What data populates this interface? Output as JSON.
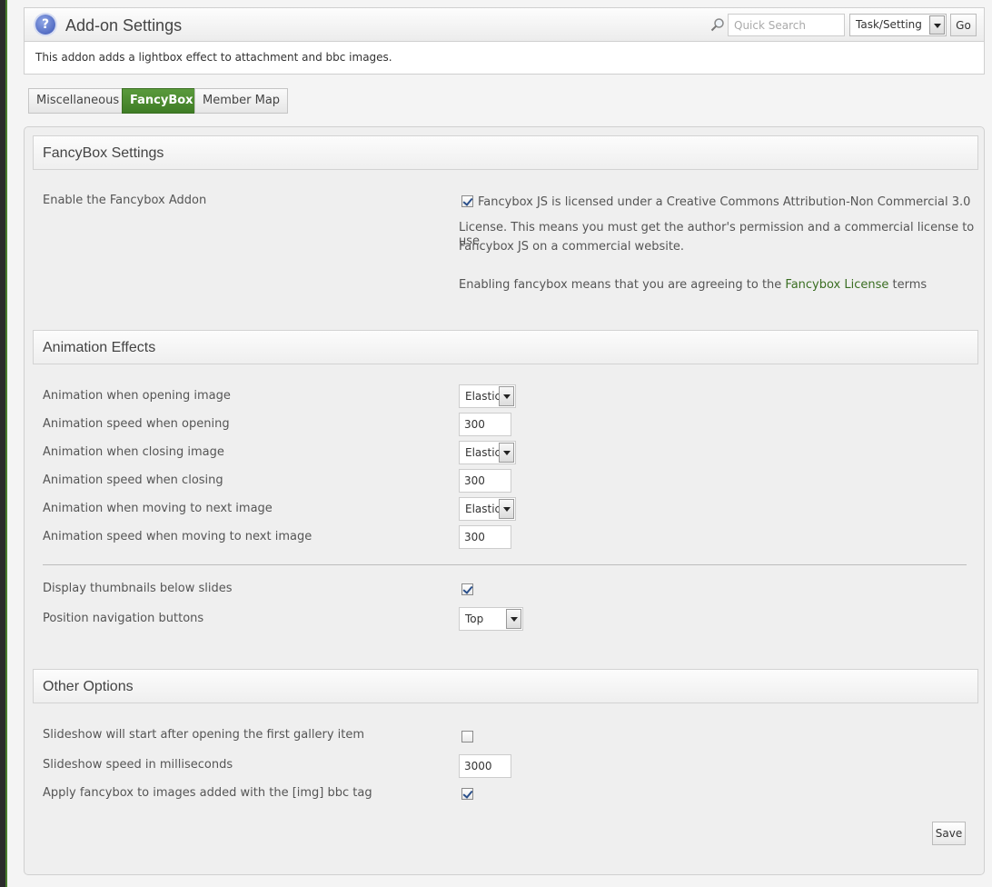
{
  "header": {
    "title": "Add-on Settings",
    "search_placeholder": "Quick Search",
    "task_select_value": "Task/Setting",
    "go_label": "Go"
  },
  "description": "This addon adds a lightbox effect to attachment and bbc images.",
  "tabs": [
    {
      "label": "Miscellaneous",
      "active": false
    },
    {
      "label": "FancyBox",
      "active": true
    },
    {
      "label": "Member Map",
      "active": false
    }
  ],
  "sections": {
    "fancybox": {
      "title": "FancyBox Settings",
      "enable_label": "Enable the Fancybox Addon",
      "enable_checked": true,
      "license_line1": "Fancybox JS is licensed under a Creative Commons Attribution-Non Commercial 3.0",
      "license_line2": "License. This means you must get the author's permission and a commercial license to use",
      "license_line3": "Fancybox JS on a commercial website.",
      "agree_prefix": "Enabling fancybox means that you are agreeing to the",
      "agree_link": "Fancybox License",
      "agree_suffix": "terms"
    },
    "animation": {
      "title": "Animation Effects",
      "open_effect_label": "Animation when opening image",
      "open_effect_value": "Elastic",
      "open_speed_label": "Animation speed when opening",
      "open_speed_value": "300",
      "close_effect_label": "Animation when closing image",
      "close_effect_value": "Elastic",
      "close_speed_label": "Animation speed when closing",
      "close_speed_value": "300",
      "next_effect_label": "Animation when moving to next image",
      "next_effect_value": "Elastic",
      "next_speed_label": "Animation speed when moving to next image",
      "next_speed_value": "300",
      "thumbs_label": "Display thumbnails below slides",
      "thumbs_checked": true,
      "nav_label": "Position navigation buttons",
      "nav_value": "Top"
    },
    "other": {
      "title": "Other Options",
      "slideshow_label": "Slideshow will start after opening the first gallery item",
      "slideshow_checked": false,
      "speed_label": "Slideshow speed in milliseconds",
      "speed_value": "3000",
      "img_tag_label": "Apply fancybox to images added with the [img] bbc tag",
      "img_tag_checked": true
    }
  },
  "save_label": "Save",
  "colors": {
    "accent_green": "#3f7d25",
    "link_green": "#3a6e22"
  }
}
